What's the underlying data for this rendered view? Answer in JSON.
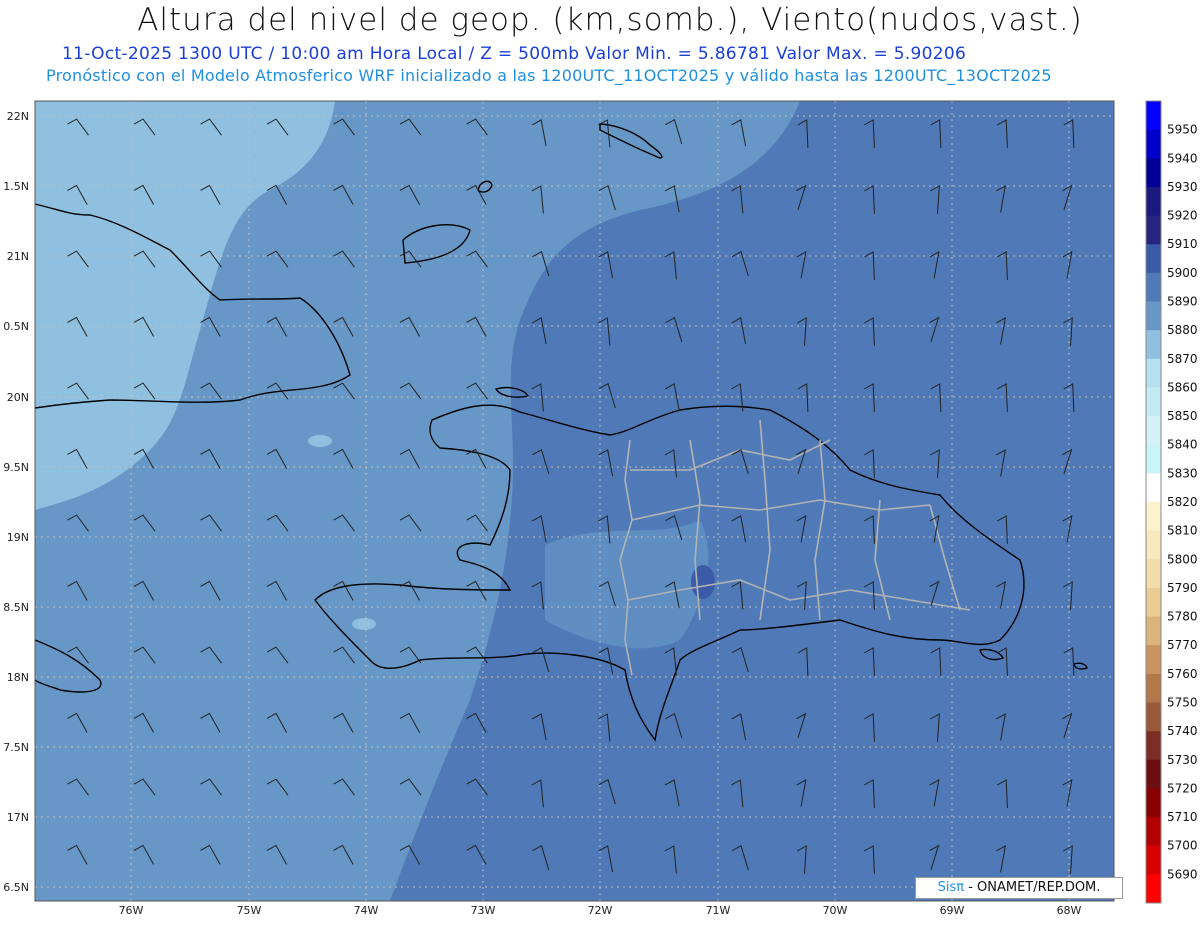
{
  "header": {
    "title": "Altura del nivel de geop. (km,somb.), Viento(nudos,vast.)",
    "line1": "11-Oct-2025  1300 UTC / 10:00 am Hora Local / Z = 500mb   Valor Min. = 5.86781  Valor Max. = 5.90206",
    "line2": "Pronóstico con el Modelo Atmosferico WRF inicializado a las 1200UTC_11OCT2025 y válido hasta las  1200UTC_13OCT2025"
  },
  "axes": {
    "x_labels": [
      "76W",
      "75W",
      "74W",
      "73W",
      "72W",
      "71W",
      "70W",
      "69W",
      "68W"
    ],
    "y_labels": [
      "22N",
      "1.5N",
      "21N",
      "0.5N",
      "20N",
      "9.5N",
      "19N",
      "8.5N",
      "18N",
      "7.5N",
      "17N",
      "6.5N"
    ]
  },
  "colorbar": {
    "labels": [
      "5950",
      "5940",
      "5930",
      "5920",
      "5910",
      "5900",
      "5890",
      "5880",
      "5870",
      "5860",
      "5850",
      "5840",
      "5830",
      "5820",
      "5810",
      "5800",
      "5790",
      "5780",
      "5770",
      "5760",
      "5750",
      "5740",
      "5730",
      "5720",
      "5710",
      "5700",
      "5690"
    ],
    "colors": [
      "#0000ff",
      "#0000cc",
      "#000099",
      "#1a1a80",
      "#262680",
      "#3b5aa8",
      "#4f7ab7",
      "#6797c7",
      "#8fc0e0",
      "#b6e0ef",
      "#c4eaf3",
      "#d4f1f7",
      "#c8f4f8",
      "#ffffff",
      "#fbf1cf",
      "#f7e8bd",
      "#f1dcaa",
      "#e8cc93",
      "#dcb37a",
      "#c99460",
      "#b3784a",
      "#9a5a3a",
      "#7e2d24",
      "#6b0f12",
      "#8a0000",
      "#b30000",
      "#d80000",
      "#ff0000"
    ]
  },
  "credit": {
    "sis": "Sisπ",
    "text": " - ONAMET/REP.DOM."
  }
}
